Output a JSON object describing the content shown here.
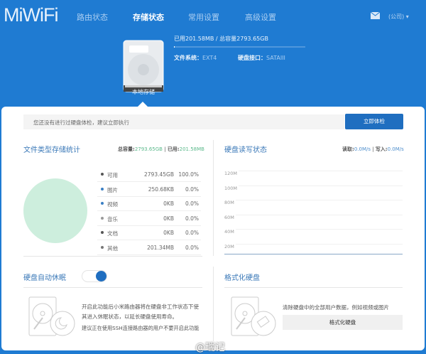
{
  "header": {
    "logo": "MiWiFi",
    "nav": [
      "路由状态",
      "存储状态",
      "常用设置",
      "高级设置"
    ],
    "active_nav": 1,
    "user": "(公司)"
  },
  "disk": {
    "label": "本地存储",
    "usage": "已用201.58MB / 总容量2793.65GB",
    "usage_fraction": 0.0001,
    "fs_label": "文件系统：",
    "fs_value": "EXT4",
    "iface_label": "硬盘接口：",
    "iface_value": "SATAIII"
  },
  "notice": {
    "text": "您还没有进行过硬盘体检，建议立即执行",
    "button": "立即体检"
  },
  "file_stats": {
    "title": "文件类型存储统计",
    "total_label": "总容量:",
    "total": "2793.65GB",
    "used_label": "已用:",
    "used": "201.58MB",
    "rows": [
      {
        "name": "可用",
        "size": "2793.45GB",
        "pct": "100.0%",
        "color": "#555555"
      },
      {
        "name": "图片",
        "size": "250.68KB",
        "pct": "0.0%",
        "color": "#3a7fc4"
      },
      {
        "name": "视频",
        "size": "0KB",
        "pct": "0.0%",
        "color": "#3a7fc4"
      },
      {
        "name": "音乐",
        "size": "0KB",
        "pct": "0.0%",
        "color": "#999999"
      },
      {
        "name": "文档",
        "size": "0KB",
        "pct": "0.0%",
        "color": "#555555"
      },
      {
        "name": "其他",
        "size": "201.34MB",
        "pct": "0.0%",
        "color": "#777777"
      }
    ]
  },
  "rw": {
    "title": "硬盘读写状态",
    "read_label": "读取:",
    "read": "0.0M/s",
    "write_label": "写入:",
    "write": "0.0M/s",
    "y_ticks": [
      "120M",
      "100M",
      "80M",
      "60M",
      "40M",
      "20M"
    ]
  },
  "sleep": {
    "title": "硬盘自动休眠",
    "enabled": true,
    "desc1": "开启此功能后小米路由器将在硬盘非工作状态下使其进入休眠状态，以延长硬盘使用寿命。",
    "desc2": "建议正在使用SSH连接路由器的用户不要开启此功能"
  },
  "format": {
    "title": "格式化硬盘",
    "desc": "清除硬盘中的全部用户数据，例如视频或图片",
    "button": "格式化硬盘"
  },
  "watermark": "@瑞记"
}
